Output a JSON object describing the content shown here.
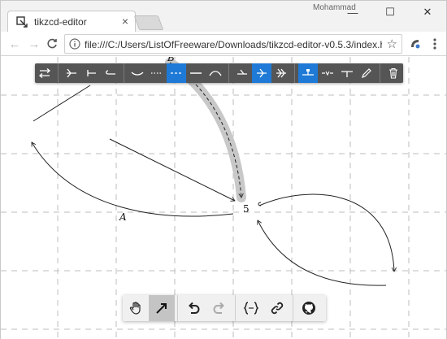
{
  "window": {
    "tab_title": "tikzcd-editor",
    "tab_close": "×",
    "profile_name": "Mohammad",
    "minimize": "—",
    "maximize": "☐",
    "close": "✕"
  },
  "addressbar": {
    "back": "←",
    "forward": "→",
    "reload": "C",
    "url": "file:///C:/Users/ListOfFreeware/Downloads/tikzcd-editor-v0.5.3/index.html...",
    "star": "☆"
  },
  "edge_toolbar": {
    "buttons": [
      {
        "name": "reverse-arrow-icon",
        "active": false
      },
      {
        "name": "tail-arrow-icon",
        "active": false
      },
      {
        "name": "tail-bar-icon",
        "active": false
      },
      {
        "name": "tail-hook-icon",
        "active": false
      },
      {
        "name": "line-solid-curved-icon",
        "active": false
      },
      {
        "name": "line-dotted-icon",
        "active": false
      },
      {
        "name": "line-dashed-icon",
        "active": true
      },
      {
        "name": "line-solid-icon",
        "active": false
      },
      {
        "name": "bend-icon",
        "active": false
      },
      {
        "name": "head-harpoon-icon",
        "active": false
      },
      {
        "name": "head-arrow-icon",
        "active": true
      },
      {
        "name": "head-double-arrow-icon",
        "active": false
      },
      {
        "name": "label-left-icon",
        "active": true
      },
      {
        "name": "label-inside-icon",
        "active": false
      },
      {
        "name": "label-right-icon",
        "active": false
      },
      {
        "name": "edit-label-pencil-icon",
        "active": false
      },
      {
        "name": "delete-trash-icon",
        "active": false
      }
    ]
  },
  "tool_bar": {
    "buttons": [
      {
        "name": "pan-hand-icon",
        "active": false
      },
      {
        "name": "arrow-tool-icon",
        "active": true
      },
      {
        "name": "undo-icon",
        "active": false
      },
      {
        "name": "redo-icon",
        "active": false
      },
      {
        "name": "code-braces-icon",
        "active": false
      },
      {
        "name": "copy-link-icon",
        "active": false
      },
      {
        "name": "github-icon",
        "active": false
      }
    ]
  },
  "diagram": {
    "node_label": "5",
    "edge_label_a": "A",
    "edge_label_b": "B"
  },
  "colors": {
    "toolbar_bg": "#555555",
    "toolbar_active": "#1e7ad6",
    "grid": "#bdbdbd",
    "selection": "#c8c8c8"
  }
}
